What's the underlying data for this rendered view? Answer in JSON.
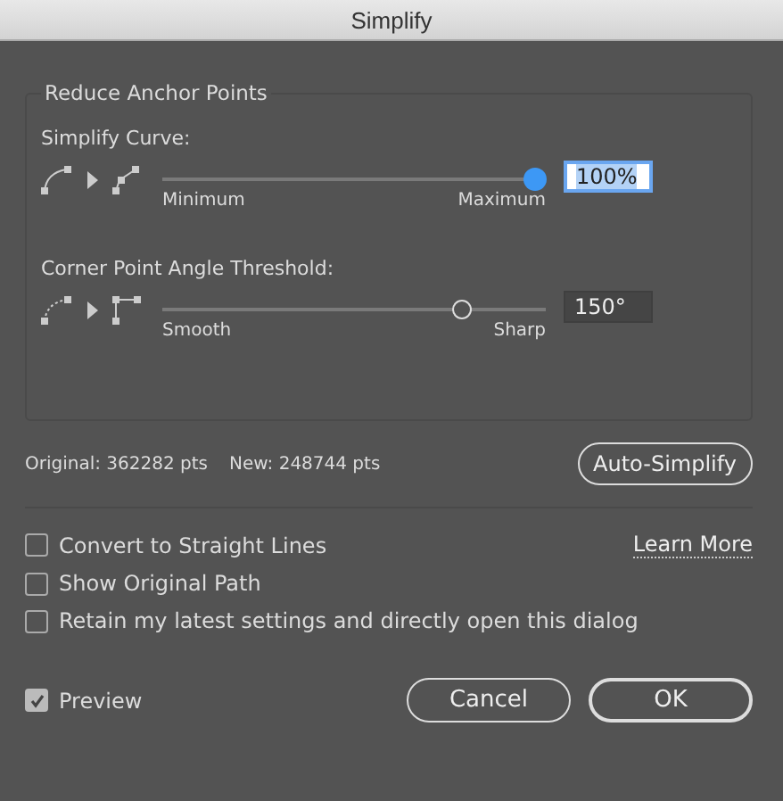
{
  "window": {
    "title": "Simplify"
  },
  "group": {
    "title": "Reduce Anchor Points",
    "sliders": [
      {
        "label": "Simplify Curve:",
        "min_label": "Minimum",
        "max_label": "Maximum",
        "level": 1.0,
        "value": "100%",
        "focused": true
      },
      {
        "label": "Corner Point Angle Threshold:",
        "min_label": "Smooth",
        "max_label": "Sharp",
        "level": 0.8,
        "value": "150°",
        "focused": false
      }
    ]
  },
  "stats": {
    "original": "Original: 362282 pts",
    "new": "New: 248744 pts"
  },
  "auto_button": "Auto-Simplify",
  "learn_more": "Learn More",
  "options": [
    {
      "label": "Convert to Straight Lines",
      "checked": false
    },
    {
      "label": "Show Original Path",
      "checked": false
    },
    {
      "label": "Retain my latest settings and directly open this dialog",
      "checked": false
    }
  ],
  "preview": {
    "label": "Preview",
    "checked": true
  },
  "buttons": [
    {
      "label": "Cancel",
      "default": false
    },
    {
      "label": "OK",
      "default": true
    }
  ]
}
